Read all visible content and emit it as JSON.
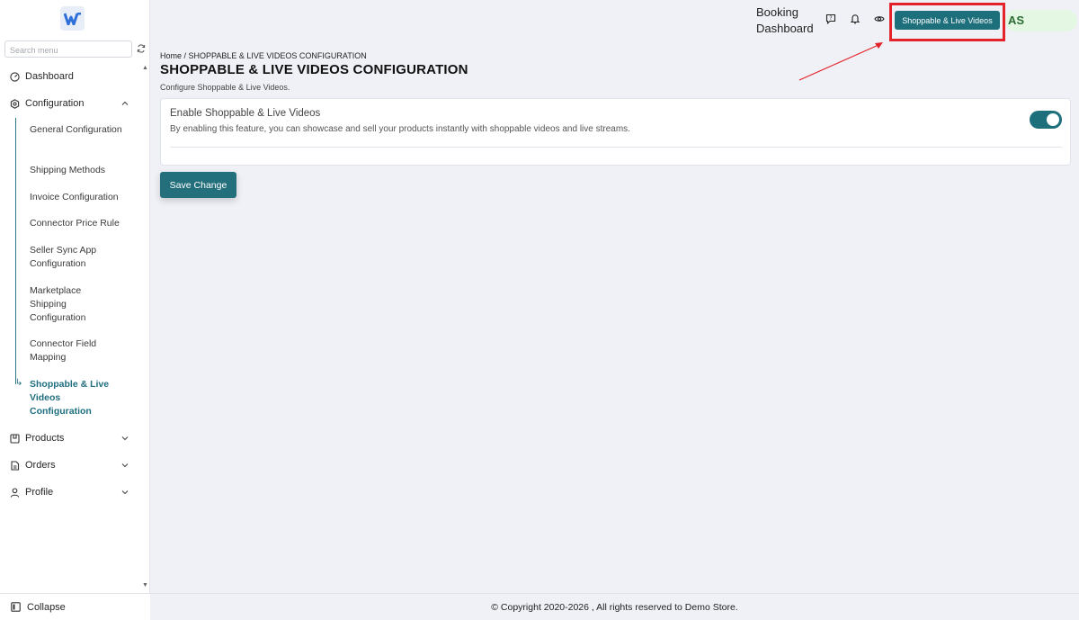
{
  "brand": {
    "logo_text": "W",
    "accent": "#1e6f7c",
    "highlight": "#e3222a"
  },
  "sidebar": {
    "search_placeholder": "Search menu",
    "items": [
      {
        "label": "Dashboard",
        "icon": "dashboard-icon"
      },
      {
        "label": "Configuration",
        "icon": "settings-icon",
        "expanded": true
      },
      {
        "label": "Products",
        "icon": "products-icon"
      },
      {
        "label": "Orders",
        "icon": "orders-icon"
      },
      {
        "label": "Profile",
        "icon": "profile-icon"
      }
    ],
    "config_sub": [
      {
        "label": "General Configuration"
      },
      {
        "label": "Shipping Methods"
      },
      {
        "label": "Invoice Configuration"
      },
      {
        "label": "Connector Price Rule"
      },
      {
        "label": "Seller Sync App Configuration"
      },
      {
        "label": "Marketplace Shipping Configuration"
      },
      {
        "label": "Connector Field Mapping"
      },
      {
        "label": "Shoppable & Live Videos Configuration",
        "active": true
      }
    ],
    "collapse_label": "Collapse"
  },
  "header": {
    "booking_label": "Booking Dashboard",
    "shop_button": "Shoppable & Live Videos",
    "avatar": "AS"
  },
  "main": {
    "breadcrumb": "Home / SHOPPABLE & LIVE VIDEOS CONFIGURATION",
    "title": "SHOPPABLE & LIVE VIDEOS CONFIGURATION",
    "subtitle": "Configure Shoppable & Live Videos.",
    "setting": {
      "title": "Enable Shoppable & Live Videos",
      "description": "By enabling this feature, you can showcase and sell your products instantly with shoppable videos and live streams.",
      "enabled": true
    },
    "save_label": "Save Change"
  },
  "footer": {
    "text": "© Copyright 2020-2026 , All rights reserved to Demo Store."
  }
}
